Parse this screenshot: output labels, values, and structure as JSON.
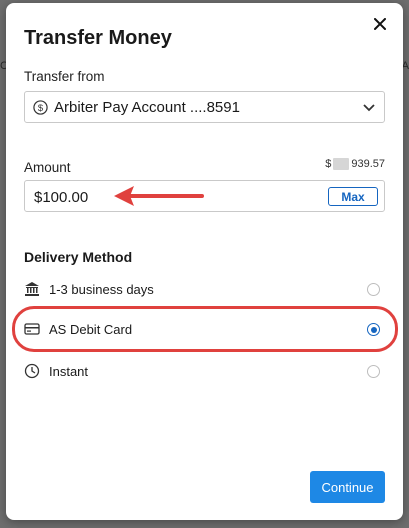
{
  "dialog": {
    "title": "Transfer Money",
    "close_icon": "close-icon"
  },
  "transfer_from": {
    "label": "Transfer from",
    "selected": "Arbiter Pay Account ....8591",
    "icon": "dollar-circle-icon"
  },
  "amount": {
    "label": "Amount",
    "balance_prefix": "$",
    "balance_suffix": "939.57",
    "value": "$100.00",
    "max_label": "Max"
  },
  "delivery": {
    "title": "Delivery Method",
    "options": [
      {
        "label": "1-3 business days",
        "icon": "bank-icon",
        "selected": false
      },
      {
        "label": "AS Debit Card",
        "icon": "card-icon",
        "selected": true
      },
      {
        "label": "Instant",
        "icon": "clock-icon",
        "selected": false
      }
    ]
  },
  "actions": {
    "continue_label": "Continue"
  },
  "colors": {
    "accent": "#1e88e5",
    "annotation": "#e0413e"
  }
}
